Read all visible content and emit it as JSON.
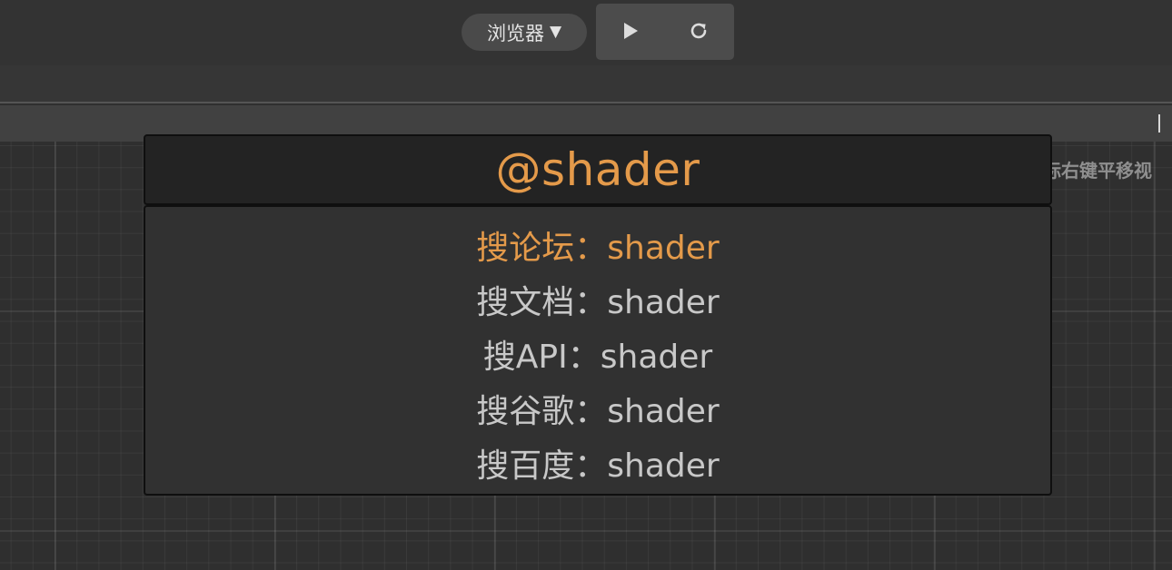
{
  "toolbar": {
    "browser_select_label": "浏览器",
    "browser_select_caret": "▼",
    "play_icon": "play-icon",
    "refresh_icon": "refresh-icon"
  },
  "scene": {
    "hint_text": "标右键平移视"
  },
  "search": {
    "query": "@shader",
    "results": [
      {
        "label": "搜论坛：shader",
        "active": true
      },
      {
        "label": "搜文档：shader",
        "active": false
      },
      {
        "label": "搜API：shader",
        "active": false
      },
      {
        "label": "搜谷歌：shader",
        "active": false
      },
      {
        "label": "搜百度：shader",
        "active": false
      }
    ]
  },
  "colors": {
    "accent": "#e49a4a",
    "text_default": "#c8c8c8",
    "toolbar_bg": "#333333",
    "panel_bg": "#313131",
    "search_bg": "#232323"
  }
}
